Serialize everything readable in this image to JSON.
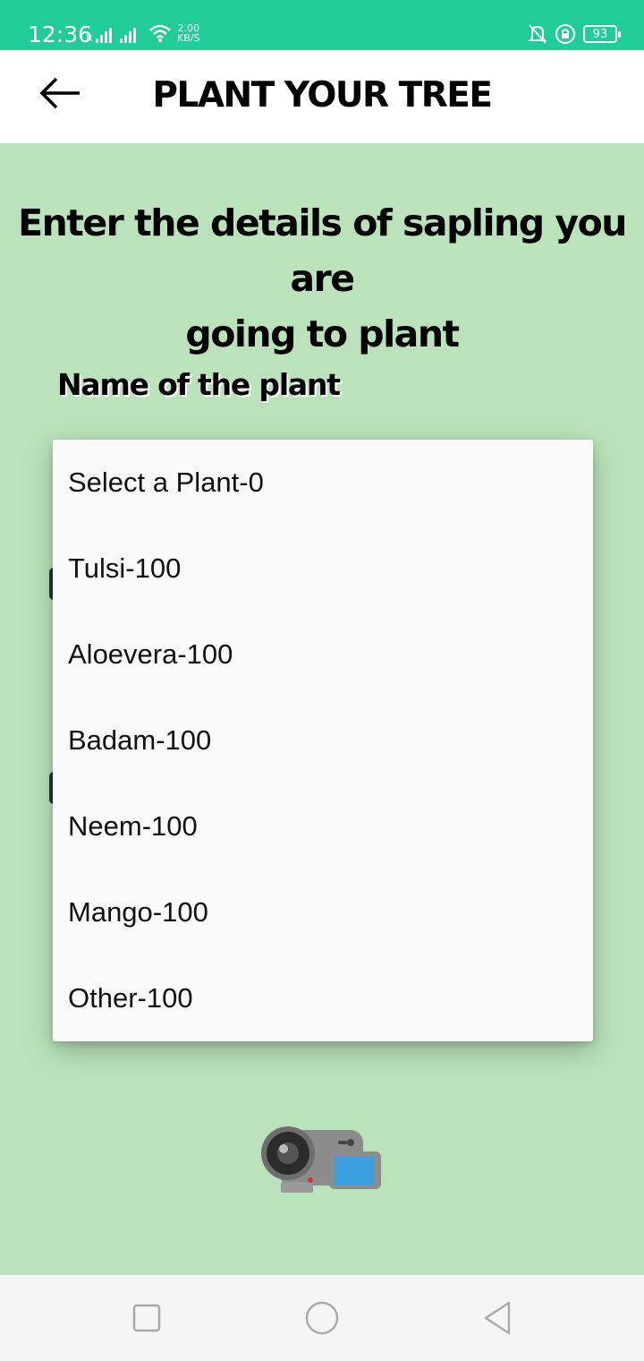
{
  "status_bar": {
    "time": "12:36",
    "net_speed_value": "2.00",
    "net_speed_unit": "KB/S",
    "battery": "93",
    "icons": [
      "signal-icon",
      "wifi-icon",
      "mute-bell-icon",
      "rotation-lock-icon",
      "battery-icon"
    ]
  },
  "toolbar": {
    "title": "PLANT YOUR TREE",
    "back_icon": "arrow-left-icon"
  },
  "main": {
    "headline_line1": "Enter the details of sapling you are",
    "headline_line2": "going to plant",
    "name_label": "Name of the plant"
  },
  "dropdown": {
    "options": [
      "Select a Plant-0",
      "Tulsi-100",
      "Aloevera-100",
      "Badam-100",
      "Neem-100",
      "Mango-100",
      "Other-100"
    ]
  },
  "camera_icon": "video-camera-icon",
  "nav_bar": {
    "icons": [
      "recents-square-icon",
      "home-circle-icon",
      "back-triangle-icon"
    ]
  },
  "colors": {
    "status_bar": "#22cc99",
    "background": "#bbe3bb",
    "toolbar": "#ffffff",
    "dropdown": "#fafafa"
  }
}
